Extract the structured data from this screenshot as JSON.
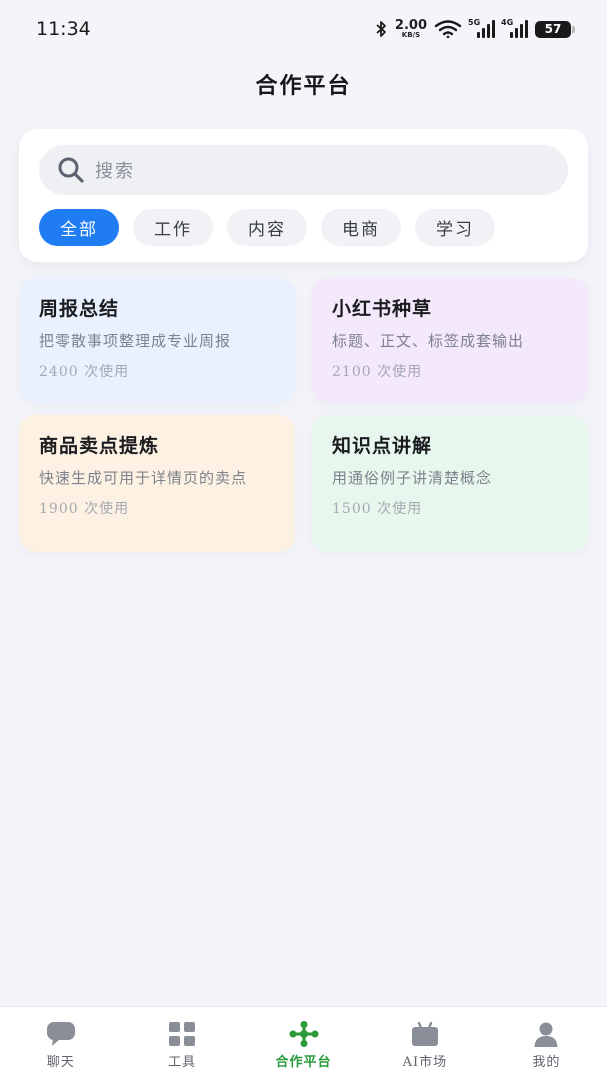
{
  "status_bar": {
    "time": "11:34",
    "net_speed": "2.00",
    "net_unit": "KB/S",
    "sig1_label": "5G",
    "sig2_label": "4G",
    "battery": "57"
  },
  "header": {
    "title": "合作平台"
  },
  "search": {
    "placeholder": "搜索",
    "icon": "search-icon"
  },
  "filters": [
    {
      "label": "全部",
      "active": true
    },
    {
      "label": "工作",
      "active": false
    },
    {
      "label": "内容",
      "active": false
    },
    {
      "label": "电商",
      "active": false
    },
    {
      "label": "学习",
      "active": false
    }
  ],
  "cards": [
    {
      "title": "周报总结",
      "desc": "把零散事项整理成专业周报",
      "usage": "2400 次使用",
      "bg": "#e9f1fe"
    },
    {
      "title": "小红书种草",
      "desc": "标题、正文、标签成套输出",
      "usage": "2100 次使用",
      "bg": "#f4e8fb"
    },
    {
      "title": "商品卖点提炼",
      "desc": "快速生成可用于详情页的卖点",
      "usage": "1900 次使用",
      "bg": "#fdf1e3"
    },
    {
      "title": "知识点讲解",
      "desc": "用通俗例子讲清楚概念",
      "usage": "1500 次使用",
      "bg": "#e8f7ee"
    }
  ],
  "tabs": [
    {
      "label": "聊天",
      "icon": "chat-icon"
    },
    {
      "label": "工具",
      "icon": "grid-icon"
    },
    {
      "label": "合作平台",
      "icon": "cooperation-icon",
      "active": true
    },
    {
      "label": "AI市场",
      "icon": "market-icon"
    },
    {
      "label": "我的",
      "icon": "profile-icon"
    }
  ],
  "colors": {
    "accent": "#1f7cf2",
    "tab_active": "#2a9a3a",
    "background": "#f4f5f9"
  }
}
